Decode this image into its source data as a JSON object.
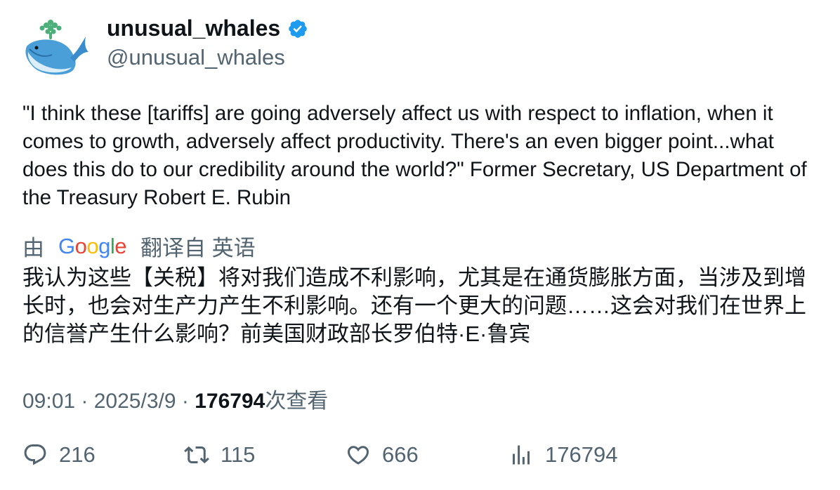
{
  "tweet": {
    "author": {
      "display_name": "unusual_whales",
      "handle": "@unusual_whales",
      "verified": true,
      "avatar_icon": "whale-icon"
    },
    "text": "\"I think these [tariffs] are going adversely affect us with respect to inflation, when it comes to growth, adversely affect productivity. There's an even bigger point...what does this do to our credibility around the world?\" Former Secretary, US Department of the Treasury Robert E. Rubin",
    "translation": {
      "by_label": "由",
      "provider": "Google",
      "from_label": "翻译自 英语",
      "text": "我认为这些【关税】将对我们造成不利影响，尤其是在通货膨胀方面，当涉及到增长时，也会对生产力产生不利影响。还有一个更大的问题……这会对我们在世界上的信誉产生什么影响？前美国财政部长罗伯特·E·鲁宾"
    },
    "meta": {
      "time": "09:01",
      "separator": " · ",
      "date": "2025/3/9",
      "views": "176794",
      "views_label": "次查看"
    },
    "actions": {
      "replies": "216",
      "retweets": "115",
      "likes": "666",
      "views": "176794"
    }
  },
  "colors": {
    "text": "#0f1419",
    "secondary": "#536471",
    "verified": "#1d9bf0"
  }
}
